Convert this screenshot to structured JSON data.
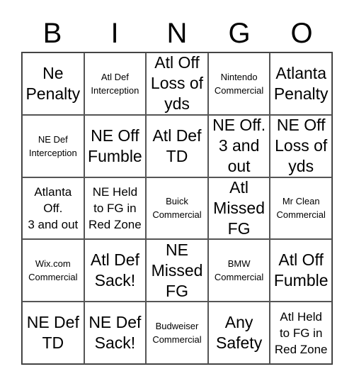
{
  "header": [
    "B",
    "I",
    "N",
    "G",
    "O"
  ],
  "cells": [
    {
      "text": "Ne\nPenalty",
      "size": "lg"
    },
    {
      "text": "Atl Def\nInterception",
      "size": "sm"
    },
    {
      "text": "Atl Off\nLoss of\nyds",
      "size": "lg"
    },
    {
      "text": "Nintendo\nCommercial",
      "size": "sm"
    },
    {
      "text": "Atlanta\nPenalty",
      "size": "lg"
    },
    {
      "text": "NE Def\nInterception",
      "size": "sm"
    },
    {
      "text": "NE Off\nFumble",
      "size": "lg"
    },
    {
      "text": "Atl Def\nTD",
      "size": "lg"
    },
    {
      "text": "NE Off.\n3 and\nout",
      "size": "lg"
    },
    {
      "text": "NE Off\nLoss of\nyds",
      "size": "lg"
    },
    {
      "text": "Atlanta\nOff.\n3 and out",
      "size": "md"
    },
    {
      "text": "NE Held\nto FG in\nRed Zone",
      "size": "md"
    },
    {
      "text": "Buick\nCommercial",
      "size": "sm"
    },
    {
      "text": "Atl\nMissed\nFG",
      "size": "lg"
    },
    {
      "text": "Mr Clean\nCommercial",
      "size": "sm"
    },
    {
      "text": "Wix.com\nCommercial",
      "size": "sm"
    },
    {
      "text": "Atl Def\nSack!",
      "size": "lg"
    },
    {
      "text": "NE\nMissed\nFG",
      "size": "lg"
    },
    {
      "text": "BMW\nCommercial",
      "size": "sm"
    },
    {
      "text": "Atl Off\nFumble",
      "size": "lg"
    },
    {
      "text": "NE Def\nTD",
      "size": "lg"
    },
    {
      "text": "NE Def\nSack!",
      "size": "lg"
    },
    {
      "text": "Budweiser\nCommercial",
      "size": "sm"
    },
    {
      "text": "Any\nSafety",
      "size": "lg"
    },
    {
      "text": "Atl Held\nto FG in\nRed Zone",
      "size": "md"
    }
  ]
}
